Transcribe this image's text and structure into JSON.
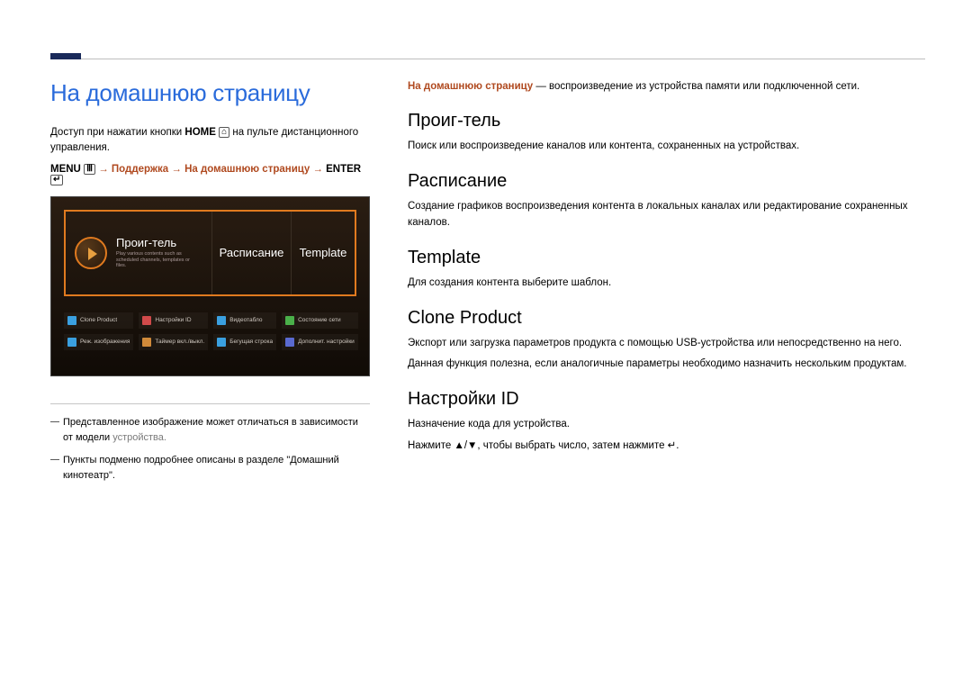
{
  "page": {
    "title": "На домашнюю страницу"
  },
  "left": {
    "intro_pre": "Доступ при нажатии кнопки ",
    "intro_home": "HOME",
    "intro_post": " на пульте дистанционного управления.",
    "menu_kw": "MENU",
    "menu_seg1": "Поддержка",
    "menu_seg2": "На домашнюю страницу",
    "menu_enter": "ENTER",
    "footnote1_a": "Представленное изображение может отличаться в зависимости от модели ",
    "footnote1_b": "устройства.",
    "footnote2": "Пункты подменю подробнее описаны в разделе \"Домашний кинотеатр\"."
  },
  "mock": {
    "play_title": "Проиг-тель",
    "play_sub": "Play various contents such as scheduled channels, templates or files.",
    "sched": "Расписание",
    "tmpl": "Template",
    "cells": [
      {
        "label": "Clone Product",
        "color": "#3aa0e0"
      },
      {
        "label": "Настройки ID",
        "color": "#d04a4a"
      },
      {
        "label": "Видеотабло",
        "color": "#3aa0e0"
      },
      {
        "label": "Состояние сети",
        "color": "#4ab04a"
      },
      {
        "label": "Реж. изображения",
        "color": "#3aa0e0"
      },
      {
        "label": "Таймер вкл./выкл.",
        "color": "#d08a3a"
      },
      {
        "label": "Бегущая строка",
        "color": "#3aa0e0"
      },
      {
        "label": "Дополнит. настройки",
        "color": "#5a6ad0"
      }
    ]
  },
  "right": {
    "lead_accent": "На домашнюю страницу",
    "lead_rest": " — воспроизведение из устройства памяти или подключенной сети.",
    "sections": [
      {
        "h": "Проиг-тель",
        "p": [
          "Поиск или воспроизведение каналов или контента, сохраненных на устройствах."
        ]
      },
      {
        "h": "Расписание",
        "p": [
          "Создание графиков воспроизведения контента в локальных каналах или редактирование сохраненных каналов."
        ]
      },
      {
        "h": "Template",
        "p": [
          "Для создания контента выберите шаблон."
        ]
      },
      {
        "h": "Clone Product",
        "p": [
          "Экспорт или загрузка параметров продукта с помощью USB-устройства или непосредственно на него.",
          "Данная функция полезна, если аналогичные параметры необходимо назначить нескольким продуктам."
        ]
      },
      {
        "h": "Настройки ID",
        "p": [
          "Назначение кода для устройства.",
          "Нажмите ▲/▼, чтобы выбрать число, затем нажмите ↵."
        ]
      }
    ]
  }
}
